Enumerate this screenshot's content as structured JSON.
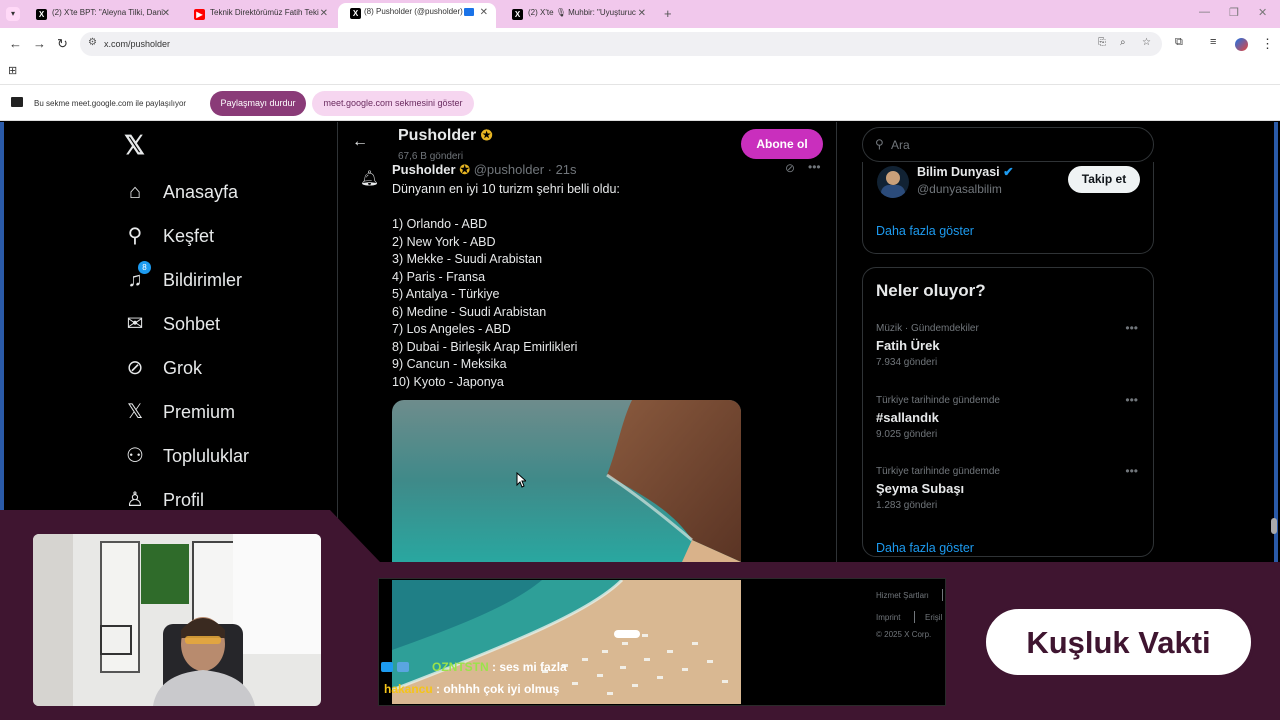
{
  "browser": {
    "tabs": [
      {
        "title": "(2) X'te BPT: \"Aleyna Tilki, Dani",
        "icon": "x-logo-icon"
      },
      {
        "title": "Teknik Direktörümüz Fatih Teki",
        "icon": "youtube-icon"
      },
      {
        "title": "(8) Pusholder (@pusholder) /",
        "icon": "x-logo-icon"
      },
      {
        "title": "(2) X'te 🎙 Muhbir: \"Uyuşturuc",
        "icon": "x-logo-icon"
      }
    ],
    "url": "x.com/pusholder",
    "share_bar": {
      "text": "Bu sekme meet.google.com ile paylaşılıyor",
      "stop_label": "Paylaşmayı durdur",
      "show_label": "meet.google.com sekmesini göster"
    }
  },
  "sidebar": {
    "items": [
      {
        "label": "Anasayfa",
        "icon": "home-icon"
      },
      {
        "label": "Keşfet",
        "icon": "search-icon"
      },
      {
        "label": "Bildirimler",
        "icon": "bell-icon",
        "badge": "8"
      },
      {
        "label": "Sohbet",
        "icon": "mail-icon"
      },
      {
        "label": "Grok",
        "icon": "grok-icon"
      },
      {
        "label": "Premium",
        "icon": "x-logo-icon"
      },
      {
        "label": "Topluluklar",
        "icon": "people-icon"
      },
      {
        "label": "Profil",
        "icon": "person-icon"
      }
    ]
  },
  "profile_header": {
    "name": "Pusholder",
    "posts": "67,6 B gönderi",
    "subscribe_label": "Abone ol"
  },
  "tweet": {
    "author": "Pusholder",
    "handle": "@pusholder · 21s",
    "text": "Dünyanın en iyi 10 turizm şehri belli oldu:\n\n1) Orlando - ABD\n2) New York - ABD\n3) Mekke - Suudi Arabistan\n4) Paris - Fransa\n5) Antalya - Türkiye\n6) Medine - Suudi Arabistan\n7) Los Angeles - ABD\n8) Dubai - Birleşik Arap Emirlikleri\n9) Cancun - Meksika\n10) Kyoto - Japonya"
  },
  "right": {
    "search_placeholder": "Ara",
    "who_to_follow": {
      "name": "Bilim Dunyasi",
      "handle": "@dunyasalbilim",
      "follow_label": "Takip et",
      "more_label": "Daha fazla göster"
    },
    "trends_title": "Neler oluyor?",
    "trends": [
      {
        "category": "Müzik · Gündemdekiler",
        "name": "Fatih Ürek",
        "count": "7.934 gönderi"
      },
      {
        "category": "Türkiye tarihinde gündemde",
        "name": "#sallandık",
        "count": "9.025 gönderi"
      },
      {
        "category": "Türkiye tarihinde gündemde",
        "name": "Şeyma Subaşı",
        "count": "1.283 gönderi"
      }
    ],
    "trends_more": "Daha fazla göster",
    "footer": {
      "terms": "Hizmet Şartları",
      "imprint": "Imprint",
      "access": "Erişil",
      "copyright": "© 2025 X Corp."
    }
  },
  "stream": {
    "chat": [
      {
        "user": "OZNTSTN",
        "message": " : ses mi fazla",
        "color": "#9be34a"
      },
      {
        "user": "hakancu",
        "message": " : ohhhh çok iyi olmuş",
        "color": "#f5c518"
      }
    ],
    "title_pill": "Kuşluk Vakti"
  }
}
